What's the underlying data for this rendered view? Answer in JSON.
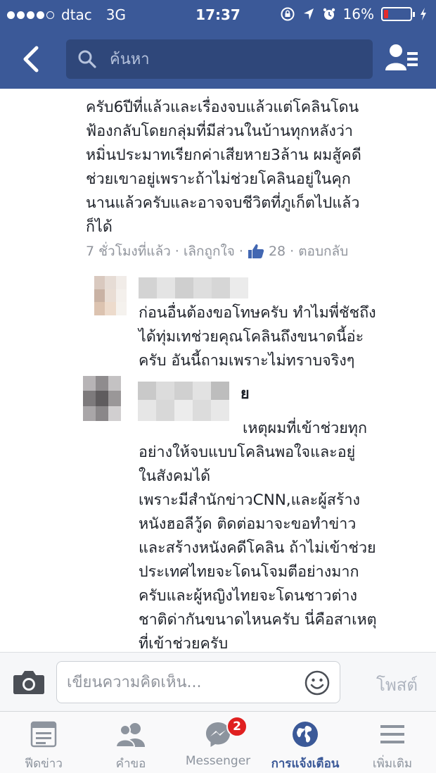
{
  "status_bar": {
    "carrier": "dtac",
    "network": "3G",
    "time": "17:37",
    "battery": "16%",
    "battery_level": 0.16
  },
  "nav": {
    "search_placeholder": "ค้นหา"
  },
  "comments": {
    "first": {
      "text": "ครับ6ปีที่แล้วและเรื่องจบแล้วแต่โคลินโดน\nฟ้องกลับโดยกลุ่มที่มีส่วนในบ้านทุกหลังว่า\nหมิ่นประมาทเรียกค่าเสียหาย3ล้าน ผมสู้คดี\nช่วยเขาอยู่เพราะถ้าไม่ช่วยโคลินอยู่ในคุก\nนานแล้วครับและอาจจบชีวิตที่ภูเก็ตไปแล้ว\nก็ได้",
      "time": "7 ชั่วโมงที่แล้ว",
      "unlike": "เลิกถูกใจ",
      "like_count": "28",
      "reply": "ตอบกลับ",
      "separator": "·"
    },
    "second": {
      "text": "ก่อนอื่นต้องขอโทษครับ ทำไมพี่ชัชถึง\nได้ทุ่มเทช่วยคุณโคลินถึงขนาดนี้อ่ะ\nครับ อันนี้ถามเพราะไม่ทราบจริงๆ"
    },
    "third": {
      "name_suffix": "ย",
      "text": "เหตุผมที่เข้าช่วยทุก\nอย่างให้จบแบบโคลินพอใจและอยู่\nในสังคมได้\nเพราะมีสำนักข่าวCNN,และผู้สร้าง\nหนังฮอลีวู้ด ติดต่อมาจะขอทำข่าว\nและสร้างหนังคดีโคลิน ถ้าไม่เข้าช่วย\nประเทศไทยจะโดนโจมตีอย่างมาก\nครับและผู้หญิงไทยจะโดนชาวต่าง\nชาติด่ากันขนาดไหนครับ นี่คือสาเหตุ\nที่เข้าช่วยครับ"
    }
  },
  "composer": {
    "placeholder": "เขียนความคิดเห็น...",
    "post_label": "โพสต์"
  },
  "tabs": [
    {
      "label": "ฟีดข่าว",
      "icon": "news-feed-icon"
    },
    {
      "label": "คำขอ",
      "icon": "friend-requests-icon"
    },
    {
      "label": "Messenger",
      "icon": "messenger-icon",
      "badge": "2"
    },
    {
      "label": "การแจ้งเตือน",
      "icon": "notifications-globe-icon"
    },
    {
      "label": "เพิ่มเติม",
      "icon": "more-menu-icon"
    }
  ],
  "colors": {
    "brand": "#3b5998",
    "like_blue": "#4267b2",
    "badge_red": "#e02020"
  }
}
